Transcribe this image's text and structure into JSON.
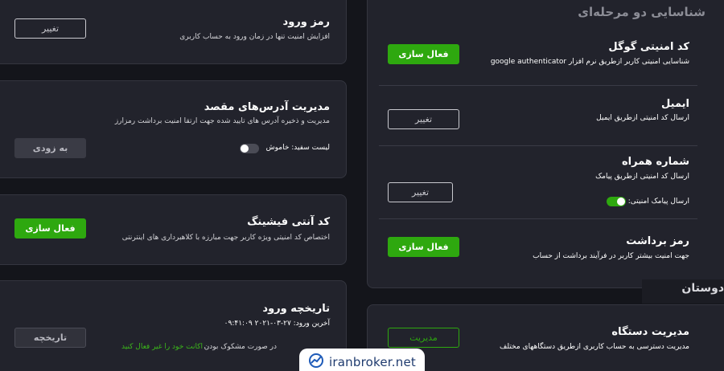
{
  "password_card": {
    "title": "رمز ورود",
    "desc": "افزایش امنیت تنها در زمان ورود به حساب کاربری",
    "button": "تغییر"
  },
  "address_card": {
    "title": "مدیریت آدرس‌های مقصد",
    "desc": "مدیریت و ذخیره آدرس های تایید شده جهت ارتقا امنیت برداشت رمزارز",
    "whitelist_label": "لیست سفید: خاموش",
    "whitelist_on": false,
    "button": "به زودی"
  },
  "phishing_card": {
    "title": "کد آنتی فیشینگ",
    "desc": "اختصاص کد امنیتی ویژه کاربر جهت مبارزه با کلاهبرداری های اینترنتی",
    "button": "فعال سازی"
  },
  "login_history_card": {
    "title": "تاریخچه ورود",
    "last_login": "آخرین ورود: ۲۷-۰۳-۲۰۲۱ ۰۹:۴۱:۰۹",
    "suspicious_text": "در صورت مشکوک بودن",
    "suspicious_link": "اکانت خود را غیر فعال کنید",
    "button": "تاریخچه"
  },
  "twofa_card": {
    "heading": "شناسایی دو مرحله‌ای",
    "items": [
      {
        "title": "کد امنیتی گوگل",
        "desc": "شناسایی امنیتی کاربر ازطریق نرم افزار google authenticator",
        "button": "فعال سازی"
      },
      {
        "title": "ایمیل",
        "desc": "ارسال کد امنیتی ازطریق ایمیل",
        "button": "تغییر"
      },
      {
        "title": "شماره همراه",
        "desc": "ارسال کد امنیتی ازطریق پیامک",
        "button": "تغییر",
        "toggle_label": "ارسال پیامک امنیتی: روشن",
        "toggle_on": true
      },
      {
        "title": "رمز برداشت",
        "desc": "جهت امنیت بیشتر کاربر در فرآیند برداشت از حساب",
        "button": "فعال سازی"
      }
    ]
  },
  "friends_tab": {
    "label": "دوستان"
  },
  "device_card": {
    "title": "مدیریت دستگاه",
    "desc": "مدیریت دسترسی به حساب کاربری ازطریق دستگاههای مختلف",
    "button": "مدیریت"
  },
  "logo": {
    "text": "iranbroker.net",
    "icon": "iranbroker-logo-icon"
  },
  "colors": {
    "accent_green": "#2ea80f",
    "card_bg": "#22232c",
    "page_bg": "#14151b"
  }
}
